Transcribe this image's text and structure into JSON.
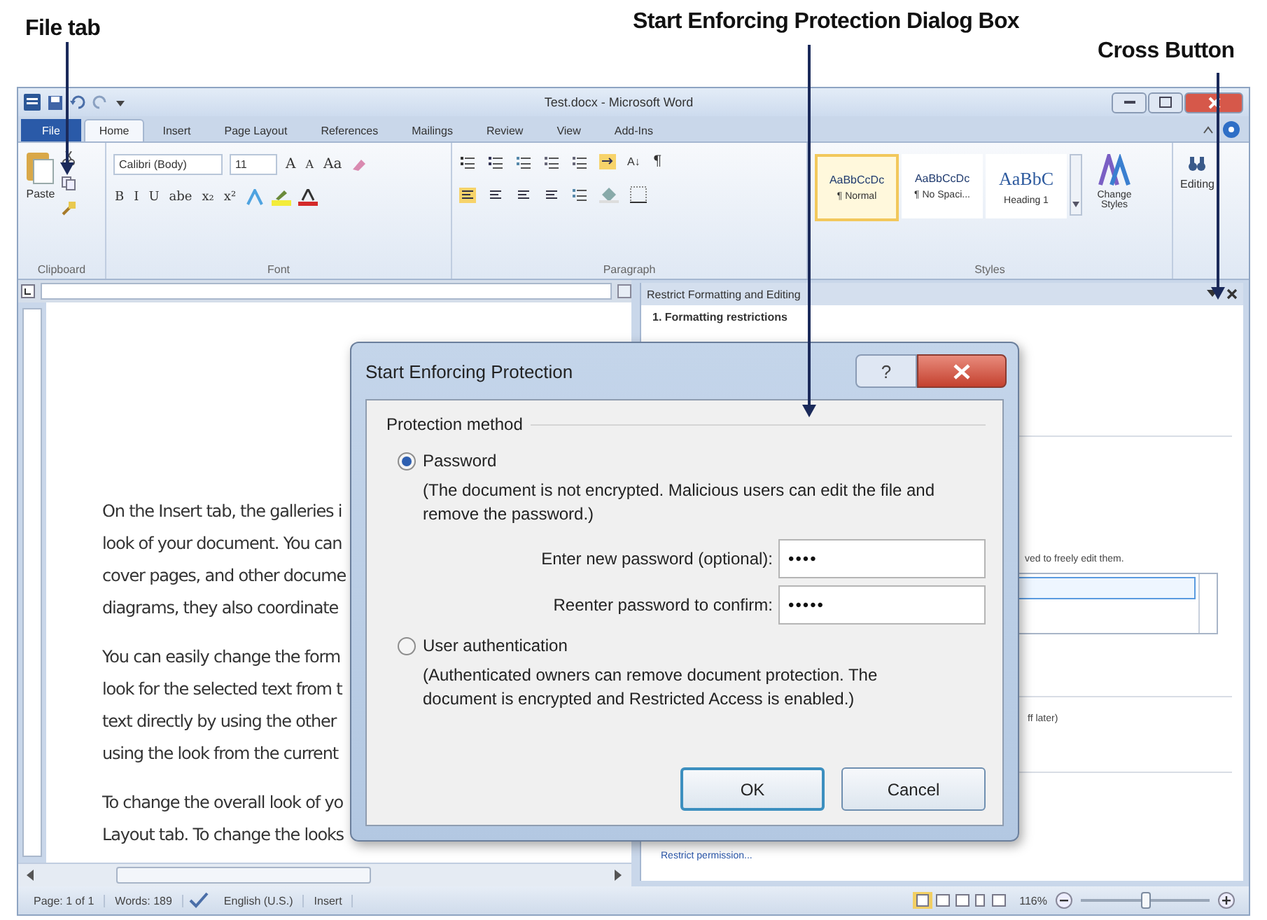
{
  "annotations": [
    {
      "text": "File tab",
      "kind": "file"
    },
    {
      "text": "Start Enforcing Protection Dialog Box",
      "kind": "dialog"
    },
    {
      "text": "Cross Button",
      "kind": "cross"
    }
  ],
  "window": {
    "title": "Test.docx - Microsoft Word"
  },
  "tabs": [
    {
      "label": "File",
      "selected": false,
      "kind": "file"
    },
    {
      "label": "Home",
      "selected": true,
      "kind": "tab"
    },
    {
      "label": "Insert",
      "selected": false,
      "kind": "tab"
    },
    {
      "label": "Page Layout",
      "selected": false,
      "kind": "tab"
    },
    {
      "label": "References",
      "selected": false,
      "kind": "tab"
    },
    {
      "label": "Mailings",
      "selected": false,
      "kind": "tab"
    },
    {
      "label": "Review",
      "selected": false,
      "kind": "tab"
    },
    {
      "label": "View",
      "selected": false,
      "kind": "tab"
    },
    {
      "label": "Add-Ins",
      "selected": false,
      "kind": "tab"
    }
  ],
  "ribbon": {
    "clipboard": {
      "paste": "Paste",
      "label": "Clipboard"
    },
    "font": {
      "family": "Calibri (Body)",
      "size": "11",
      "grow": "A",
      "shrink": "A",
      "case": "Aa",
      "format": [
        "B",
        "I",
        "U",
        "abe",
        "x₂",
        "x²"
      ],
      "label": "Font"
    },
    "paragraph": {
      "label": "Paragraph",
      "sort": "A↓",
      "pilcrow": "¶"
    },
    "styles": {
      "label": "Styles",
      "items": [
        {
          "sample": "AaBbCcDc",
          "name": "¶ Normal",
          "selected": true
        },
        {
          "sample": "AaBbCcDc",
          "name": "¶ No Spaci...",
          "selected": false
        },
        {
          "sample": "AaBbC",
          "name": "Heading 1",
          "selected": false
        }
      ],
      "change": "Change Styles"
    },
    "editing": {
      "label": "Editing"
    }
  },
  "document": {
    "paragraphs": [
      [
        "On the Insert tab, the galleries i",
        "look of your document. You can",
        "cover pages, and other docume",
        "diagrams, they also coordinate"
      ],
      [
        "You can easily change the form",
        "look for the selected text from t",
        "text directly by using the other",
        "using the look from the current"
      ],
      [
        "To change the overall look of yo",
        "Layout tab. To change the looks"
      ]
    ]
  },
  "pane": {
    "title": "Restrict Formatting and Editing",
    "heading": "1. Formatting restrictions",
    "fragment_1": "ved to freely edit them.",
    "fragment_2": "ff later)",
    "link": "Restrict permission..."
  },
  "dialog": {
    "title": "Start Enforcing Protection",
    "help": "?",
    "group": "Protection method",
    "options": [
      {
        "label": "Password",
        "selected": true,
        "description": "(The document is not encrypted. Malicious users can edit the file and remove the password.)"
      },
      {
        "label": "User authentication",
        "selected": false,
        "description": "(Authenticated owners can remove document protection. The document is encrypted and Restricted Access is enabled.)"
      }
    ],
    "fields": [
      {
        "label": "Enter new password (optional):",
        "value": "••••"
      },
      {
        "label": "Reenter password to confirm:",
        "value": "•••••"
      }
    ],
    "buttons": [
      "OK",
      "Cancel"
    ]
  },
  "status_bar": {
    "items": [
      "Page: 1 of 1",
      "Words: 189",
      "English (U.S.)",
      "Insert"
    ],
    "zoom": "116%",
    "zoom_slider": {
      "level": 0.5
    }
  }
}
